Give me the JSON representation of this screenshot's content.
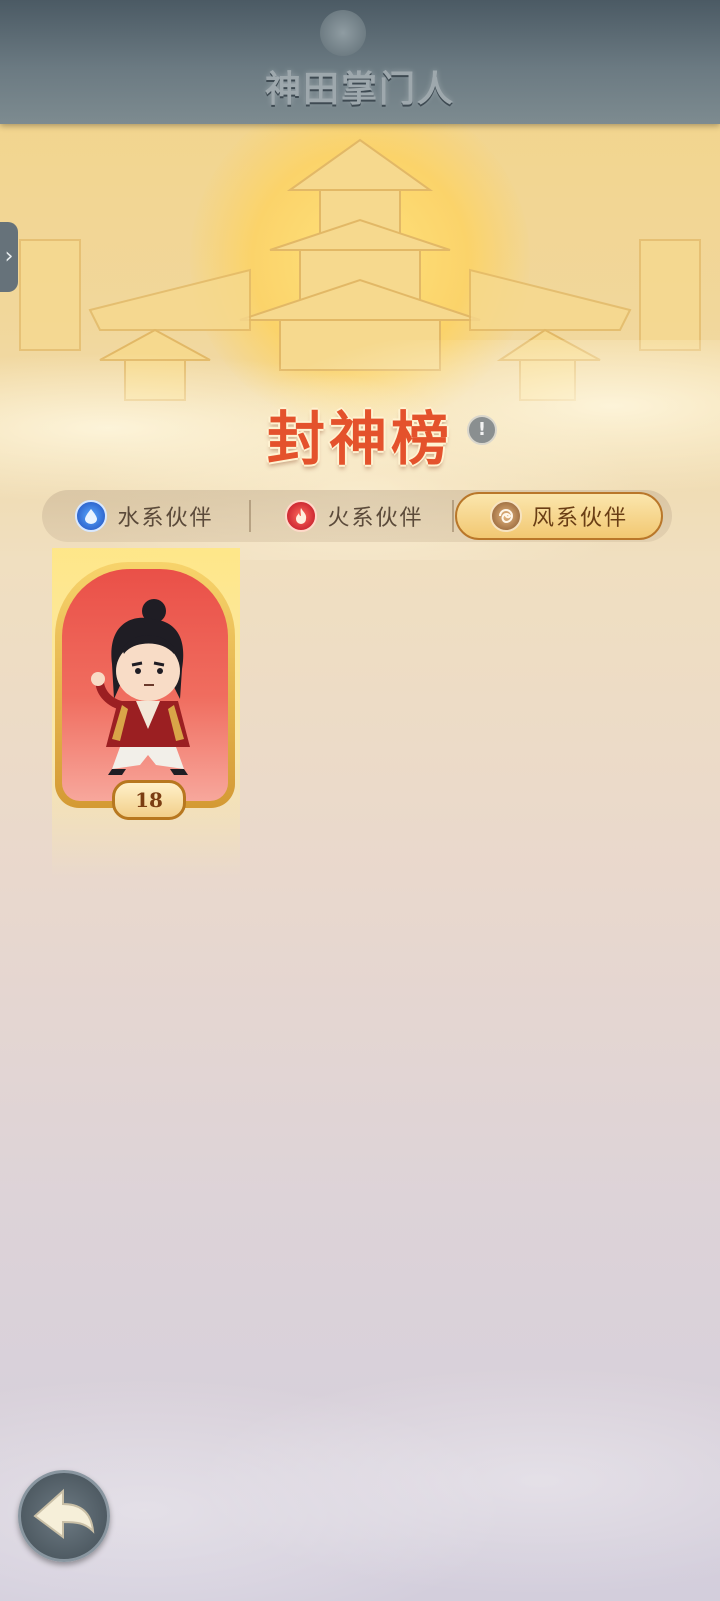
{
  "header": {
    "title": "神田掌门人"
  },
  "side_handle": {
    "icon": "chevron-right-icon",
    "glyph": "›"
  },
  "page": {
    "title": "封神榜",
    "info_glyph": "!"
  },
  "tabs": [
    {
      "label": "水系伙伴",
      "icon": "water-drop-icon",
      "active": false
    },
    {
      "label": "火系伙伴",
      "icon": "fire-icon",
      "active": false
    },
    {
      "label": "风系伙伴",
      "icon": "wind-swirl-icon",
      "active": true
    }
  ],
  "cards": [
    {
      "character": "warrior-chibi",
      "level": "18"
    }
  ],
  "colors": {
    "title_red": "#e4522c",
    "active_tab": "#f2c872",
    "card_bg": "#ea5048",
    "header_bg": "#5b6a73"
  }
}
